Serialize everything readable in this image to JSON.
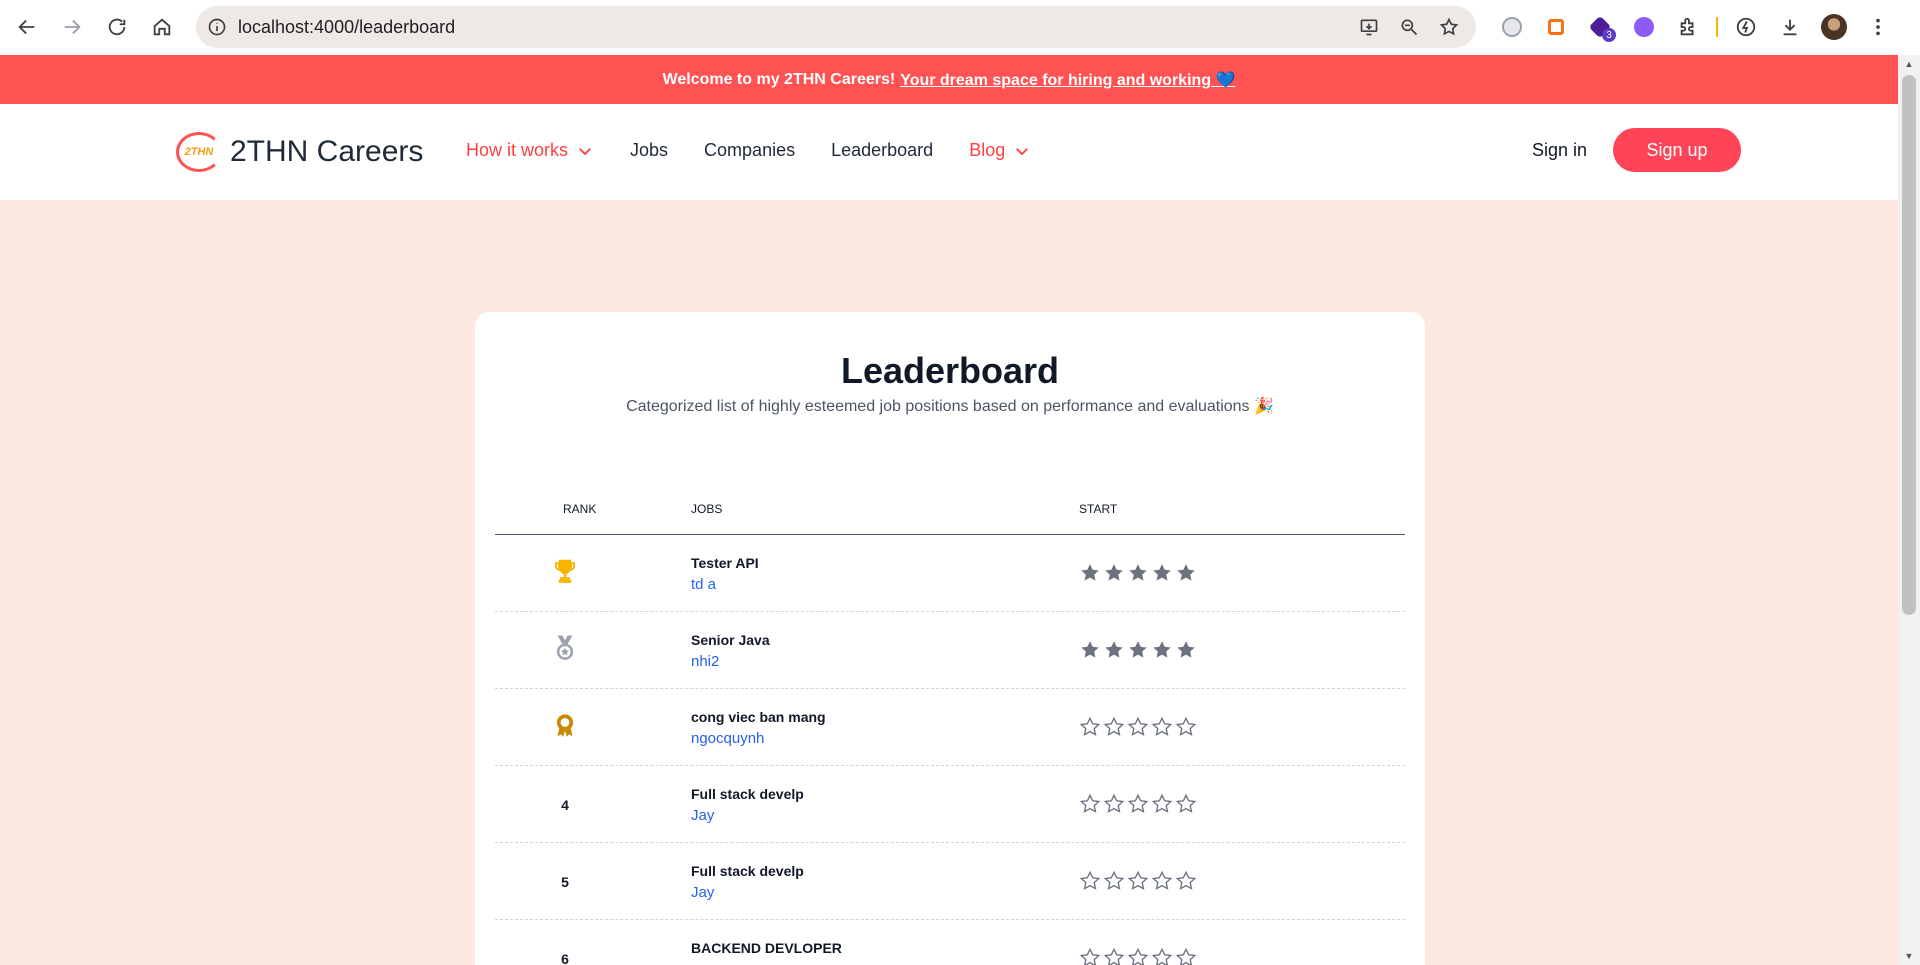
{
  "browser": {
    "url": "localhost:4000/leaderboard",
    "extension_badge": "3"
  },
  "announcement": {
    "bold": "Welcome",
    "middle": " to my 2THN Careers!",
    "link": "Your dream space for hiring and working",
    "emoji": "💙"
  },
  "header": {
    "logo_mark": "2THN",
    "brand": "2THN Careers",
    "menu": [
      {
        "label": "How it works",
        "accent": true,
        "dropdown": true
      },
      {
        "label": "Jobs",
        "accent": false,
        "dropdown": false
      },
      {
        "label": "Companies",
        "accent": false,
        "dropdown": false
      },
      {
        "label": "Leaderboard",
        "accent": false,
        "dropdown": false
      },
      {
        "label": "Blog",
        "accent": true,
        "dropdown": true
      }
    ],
    "signin": "Sign in",
    "signup": "Sign up"
  },
  "leaderboard": {
    "title": "Leaderboard",
    "subtitle": "Categorized list of highly esteemed job positions based on performance and evaluations 🎉",
    "columns": {
      "rank": "RANK",
      "jobs": "JOBS",
      "start": "START"
    },
    "rows": [
      {
        "rank": "1",
        "rank_icon": "trophy-icon",
        "title": "Tester API",
        "company": "td a",
        "stars": 5
      },
      {
        "rank": "2",
        "rank_icon": "silver-medal-icon",
        "title": "Senior Java",
        "company": "nhi2",
        "stars": 5
      },
      {
        "rank": "3",
        "rank_icon": "bronze-medal-icon",
        "title": "cong viec ban mang",
        "company": "ngocquynh",
        "stars": 0
      },
      {
        "rank": "4",
        "rank_icon": "",
        "title": "Full stack develp",
        "company": "Jay",
        "stars": 0
      },
      {
        "rank": "5",
        "rank_icon": "",
        "title": "Full stack develp",
        "company": "Jay",
        "stars": 0
      },
      {
        "rank": "6",
        "rank_icon": "",
        "title": "BACKEND DEVLOPER",
        "company": "",
        "stars": 0
      }
    ]
  },
  "colors": {
    "accent": "#ff4040",
    "announcement_bg": "#ff5252",
    "page_bg": "#fde8e2",
    "star_filled": "#6b7280",
    "link": "#2563eb"
  }
}
